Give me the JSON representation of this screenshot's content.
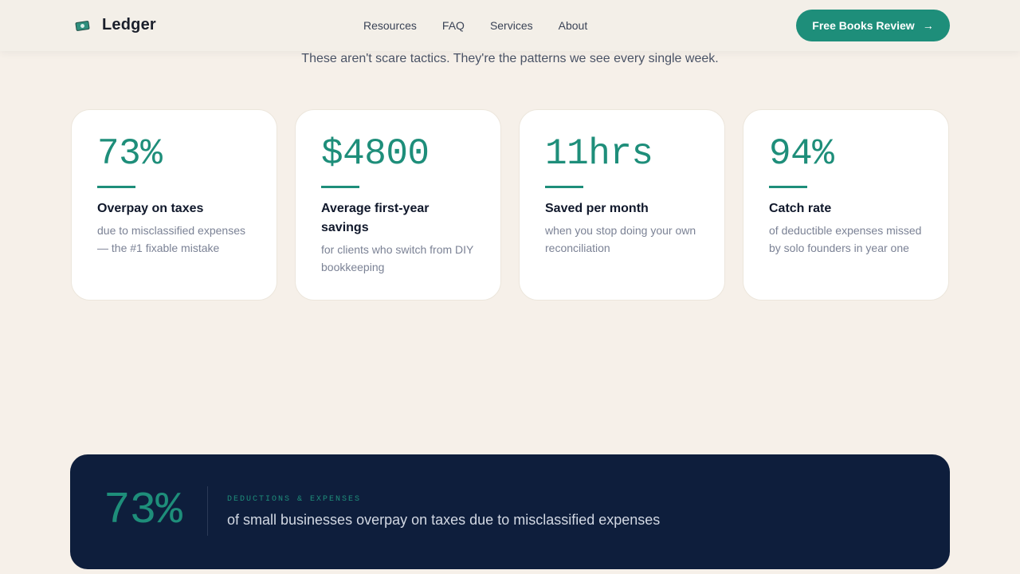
{
  "header": {
    "brand": "Ledger",
    "nav": [
      "Resources",
      "FAQ",
      "Services",
      "About"
    ],
    "cta_label": "Free Books Review",
    "cta_icon": "arrow-right-icon",
    "logo_icon": "money-icon"
  },
  "intro": {
    "subtitle": "These aren't scare tactics. They're the patterns we see every single week."
  },
  "stats": [
    {
      "value": "73%",
      "label": "Overpay on taxes",
      "desc": "due to misclassified expenses — the #1 fixable mistake"
    },
    {
      "value": "$4800",
      "label": "Average first-year savings",
      "desc": "for clients who switch from DIY bookkeeping"
    },
    {
      "value": "11hrs",
      "label": "Saved per month",
      "desc": "when you stop doing your own reconciliation"
    },
    {
      "value": "94%",
      "label": "Catch rate",
      "desc": "of deductible expenses missed by solo founders in year one"
    }
  ],
  "banner": {
    "value": "73%",
    "kicker": "DEDUCTIONS & EXPENSES",
    "text": "of small businesses overpay on taxes due to misclassified expenses"
  },
  "colors": {
    "accent": "#1e8e7a",
    "background": "#f6f0e9",
    "banner": "#0e1e3c"
  }
}
